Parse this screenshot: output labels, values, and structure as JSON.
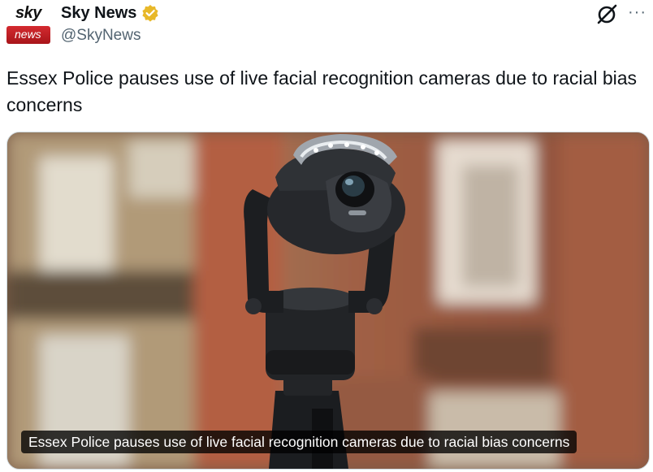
{
  "account": {
    "avatar_top": "sky",
    "avatar_bottom": "news",
    "display_name": "Sky News",
    "handle": "@SkyNews"
  },
  "icons": {
    "verified": "verified-badge-icon",
    "grok": "grok-icon",
    "more": "more-options-icon"
  },
  "more_label": "···",
  "tweet": {
    "text": "Essex Police pauses use of live facial recognition cameras due to racial bias concerns"
  },
  "media": {
    "caption": "Essex Police pauses use of live facial recognition cameras due to racial bias concerns"
  },
  "colors": {
    "verified": "#e8b829",
    "brand_red": "#c41e24",
    "secondary_text": "#536471"
  }
}
